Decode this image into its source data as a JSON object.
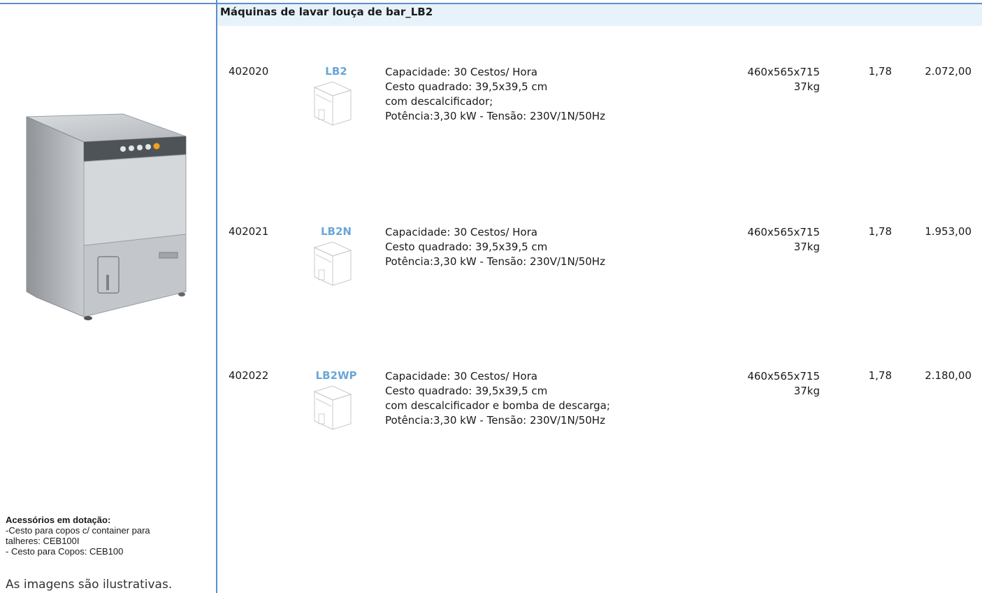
{
  "header": {
    "title": "Máquinas de lavar louça de bar_LB2"
  },
  "sidebar": {
    "machine_image_alt": "dishwasher-photo",
    "accessories_title": "Acessórios em dotação:",
    "accessories_lines": [
      "-Cesto para copos c/ container para",
      "talheres: CEB100I",
      "- Cesto para Copos: CEB100"
    ],
    "disclaimer": "As imagens são ilustrativas."
  },
  "products": [
    {
      "code": "402020",
      "model": "LB2",
      "description": [
        "Capacidade: 30 Cestos/ Hora",
        "Cesto quadrado: 39,5x39,5 cm",
        "com descalcificador;",
        "Potência:3,30 kW  - Tensão: 230V/1N/50Hz"
      ],
      "dimensions": "460x565x715",
      "weight": "37kg",
      "volume": "1,78",
      "price": "2.072,00"
    },
    {
      "code": "402021",
      "model": "LB2N",
      "description": [
        "Capacidade: 30 Cestos/ Hora",
        "Cesto quadrado: 39,5x39,5 cm",
        "Potência:3,30 kW  - Tensão: 230V/1N/50Hz"
      ],
      "dimensions": "460x565x715",
      "weight": "37kg",
      "volume": "1,78",
      "price": "1.953,00"
    },
    {
      "code": "402022",
      "model": "LB2WP",
      "description": [
        "Capacidade: 30 Cestos/ Hora",
        "Cesto quadrado: 39,5x39,5 cm",
        "com descalcificador e bomba de descarga;",
        "Potência:3,30 kW  - Tensão: 230V/1N/50Hz"
      ],
      "dimensions": "460x565x715",
      "weight": "37kg",
      "volume": "1,78",
      "price": "2.180,00"
    }
  ],
  "colors": {
    "accent": "#5b8fc9",
    "model": "#6aa6d8",
    "header_bg": "#e8f2fa"
  }
}
